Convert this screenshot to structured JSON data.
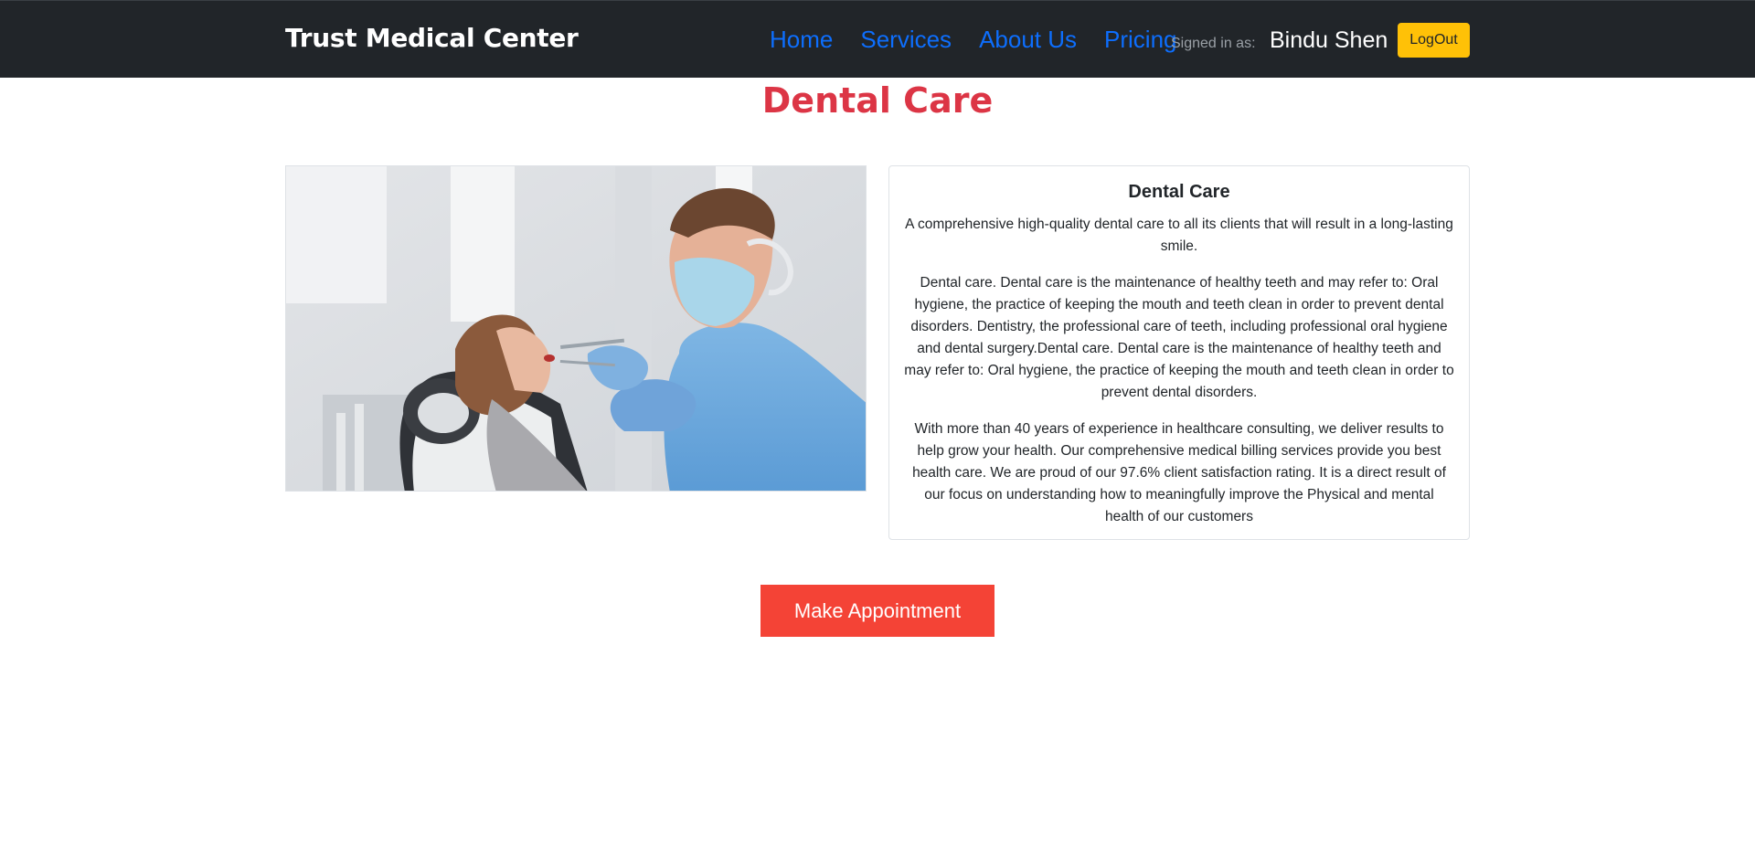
{
  "navbar": {
    "brand": "Trust Medical Center",
    "links": [
      "Home",
      "Services",
      "About Us",
      "Pricing"
    ],
    "signed_in_label": "Signed in as:",
    "user_name": "Bindu Shen",
    "logout_label": "LogOut"
  },
  "main": {
    "title": "Dental Care",
    "image_icon": "dentist-photo",
    "card": {
      "title": "Dental Care",
      "paragraphs": [
        "A comprehensive high-quality dental care to all its clients that will result in a long-lasting smile.",
        "Dental care. Dental care is the maintenance of healthy teeth and may refer to: Oral hygiene, the practice of keeping the mouth and teeth clean in order to prevent dental disorders. Dentistry, the professional care of teeth, including professional oral hygiene and dental surgery.Dental care. Dental care is the maintenance of healthy teeth and may refer to: Oral hygiene, the practice of keeping the mouth and teeth clean in order to prevent dental disorders.",
        "With more than 40 years of experience in healthcare consulting, we deliver results to help grow your health. Our comprehensive medical billing services provide you best health care. We are proud of our 97.6% client satisfaction rating. It is a direct result of our focus on understanding how to meaningfully improve the Physical and mental health of our customers"
      ]
    },
    "appointment_label": "Make Appointment"
  },
  "colors": {
    "navbar_bg": "#212529",
    "link": "#0d6efd",
    "title": "#dc3545",
    "logout_bg": "#ffc107",
    "appointment_bg": "#f44336"
  }
}
